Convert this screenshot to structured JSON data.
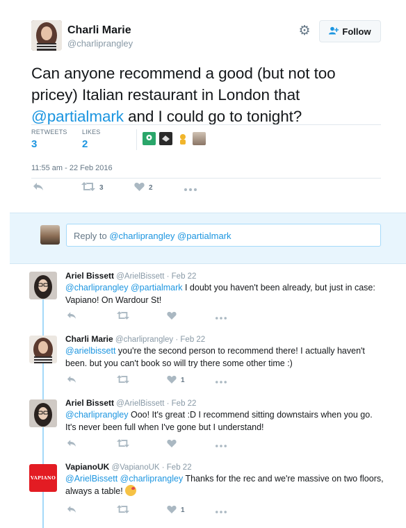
{
  "main_tweet": {
    "author_name": "Charli Marie",
    "author_handle": "@charliprangley",
    "follow_label": "Follow",
    "text_before": "Can anyone recommend a good (but not too pricey) Italian restaurant in London that ",
    "text_mention": "@partialmark",
    "text_after": " and I could go to tonight?",
    "retweets_label": "RETWEETS",
    "retweets_count": "3",
    "likes_label": "LIKES",
    "likes_count": "2",
    "timestamp": "11:55 am - 22 Feb 2016",
    "action_retweet_count": "3",
    "action_like_count": "2"
  },
  "reply_box": {
    "prefix": "Reply to ",
    "mentions": "@charliprangley @partialmark"
  },
  "replies": [
    {
      "name": "Ariel Bissett",
      "handle_time": "@ArielBissett · Feb 22",
      "mention": "@charliprangley @partialmark",
      "text": " I doubt you haven't been already, but just in case: Vapiano! On Wardour St!",
      "like_count": ""
    },
    {
      "name": "Charli Marie",
      "handle_time": "@charliprangley · Feb 22",
      "mention": "@arielbissett",
      "text": " you're the second person to recommend there! I actually haven't been. but you can't book so will try there some other time :)",
      "like_count": "1"
    },
    {
      "name": "Ariel Bissett",
      "handle_time": "@ArielBissett · Feb 22",
      "mention": "@charliprangley",
      "text": " Ooo! It's great :D I recommend sitting downstairs when you go. It's never been full when I've gone but I understand!",
      "like_count": ""
    },
    {
      "name": "VapianoUK",
      "handle_time": "@VapianoUK · Feb 22",
      "mention": "@ArielBissett @charliprangley",
      "text": " Thanks for the rec and we're massive on two floors, always a table! ",
      "like_count": "1",
      "avatar_text": "VAPIANO"
    }
  ],
  "icons": {
    "reply": "reply-icon",
    "retweet": "retweet-icon",
    "like": "heart-icon",
    "more": "more-icon",
    "settings": "gear-icon",
    "follow": "add-user-icon"
  },
  "colors": {
    "link": "#1b95e0",
    "reply_bar_bg": "#e8f5fd",
    "thread_line": "#a4d9f9",
    "vapiano_red": "#e31c23"
  }
}
